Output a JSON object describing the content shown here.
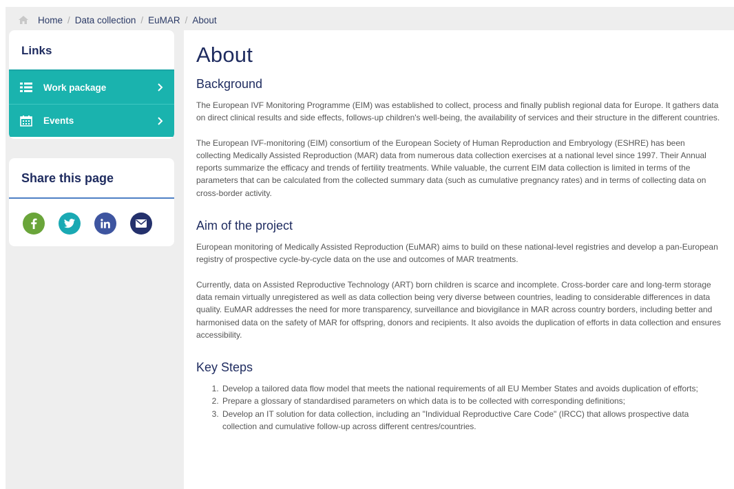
{
  "breadcrumb": {
    "items": [
      "Home",
      "Data collection",
      "EuMAR",
      "About"
    ],
    "separator": "/"
  },
  "sidebar": {
    "links_title": "Links",
    "links": [
      {
        "label": "Work package",
        "icon": "list-icon"
      },
      {
        "label": "Events",
        "icon": "calendar-icon"
      }
    ],
    "share_title": "Share this page",
    "share": [
      {
        "name": "facebook",
        "glyph": "f",
        "color": "#6aa53a"
      },
      {
        "name": "twitter",
        "glyph": "t",
        "color": "#1aa9b3"
      },
      {
        "name": "linkedin",
        "glyph": "in",
        "color": "#3e55a0"
      },
      {
        "name": "email",
        "glyph": "@",
        "color": "#24316c"
      }
    ]
  },
  "main": {
    "title": "About",
    "background": {
      "heading": "Background",
      "p1": "The European IVF Monitoring Programme (EIM) was established to collect, process and finally publish regional data for Europe. It gathers data on direct clinical results and side effects, follows-up children's well-being, the availability of services and their structure in the different countries.",
      "p2": "The European IVF-monitoring (EIM) consortium of the European Society of Human Reproduction and Embryology (ESHRE) has been collecting Medically Assisted Reproduction (MAR) data from numerous data collection exercises at a national level since 1997. Their Annual reports summarize the efficacy and trends of fertility treatments. While valuable, the current EIM data collection is limited in terms of the parameters that can be calculated from the collected summary data (such as cumulative pregnancy rates) and in terms of collecting data on cross-border activity."
    },
    "aim": {
      "heading": "Aim of the project",
      "p1": "European monitoring of Medically Assisted Reproduction (EuMAR) aims to build on these national-level registries and develop a pan-European registry of prospective cycle-by-cycle data on the use and outcomes of MAR treatments.",
      "p2": "Currently, data on Assisted Reproductive Technology (ART) born children is scarce and incomplete. Cross-border care and long-term storage data remain virtually unregistered as well as data collection being very diverse between countries, leading to considerable differences in data quality. EuMAR addresses the need for more transparency, surveillance and biovigilance in MAR across country borders, including better and harmonised data on the safety of MAR for offspring, donors and recipients. It also avoids the duplication of efforts in data collection and ensures accessibility."
    },
    "keysteps": {
      "heading": "Key Steps",
      "items": [
        "Develop a tailored data flow model that meets the national requirements of all EU Member States and avoids duplication of efforts;",
        "Prepare a glossary of standardised parameters on which data is to be collected with corresponding definitions;",
        "Develop an IT solution for data collection, including an \"Individual Reproductive Care Code\" (IRCC) that allows prospective data collection and cumulative follow-up across different centres/countries."
      ]
    }
  }
}
